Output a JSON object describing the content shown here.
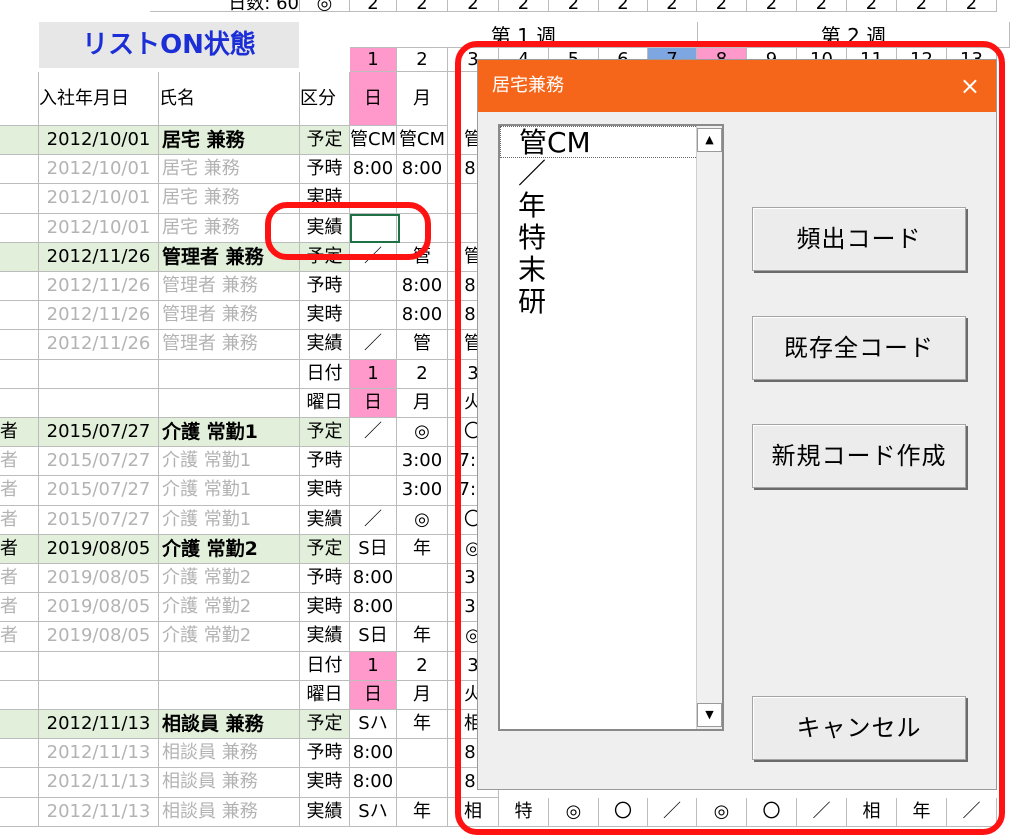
{
  "header": {
    "top_label": "日数: 60",
    "top_symbol": "◎"
  },
  "sheet_title": "リストON状態",
  "weeks": [
    "第 1 週",
    "第 2 週"
  ],
  "col_headers": {
    "date": "入社年月日",
    "name": "氏名",
    "kubun": "区分"
  },
  "days_number_row": [
    "2",
    "2",
    "2",
    "2",
    "2",
    "2",
    "2",
    "2",
    "2",
    "2",
    "2",
    "2",
    "2"
  ],
  "header_day_nums": [
    "1",
    "2",
    "3",
    "4",
    "5",
    "6",
    "7",
    "8",
    "9",
    "10",
    "11",
    "12",
    "13"
  ],
  "header_weekdays": [
    "日",
    "月"
  ],
  "rows": [
    {
      "kind": "emp",
      "date": "2012/10/01",
      "name": "居宅 兼務",
      "type": "予定",
      "bold": true,
      "cells": [
        "管CM",
        "管CM",
        "管"
      ]
    },
    {
      "kind": "emp",
      "date": "2012/10/01",
      "name": "居宅 兼務",
      "type": "予時",
      "grey": true,
      "cells": [
        "8:00",
        "8:00",
        "8:"
      ]
    },
    {
      "kind": "emp",
      "date": "2012/10/01",
      "name": "居宅 兼務",
      "type": "実時",
      "grey": true,
      "cells": [
        "",
        "",
        ""
      ]
    },
    {
      "kind": "emp",
      "date": "2012/10/01",
      "name": "居宅 兼務",
      "type": "実績",
      "grey": true,
      "cells": [
        "",
        "",
        ""
      ]
    },
    {
      "kind": "emp",
      "date": "2012/11/26",
      "name": "管理者 兼務",
      "type": "予定",
      "bold": true,
      "cells": [
        "／",
        "管",
        "管"
      ]
    },
    {
      "kind": "emp",
      "date": "2012/11/26",
      "name": "管理者 兼務",
      "type": "予時",
      "grey": true,
      "cells": [
        "",
        "8:00",
        "8:"
      ]
    },
    {
      "kind": "emp",
      "date": "2012/11/26",
      "name": "管理者 兼務",
      "type": "実時",
      "grey": true,
      "cells": [
        "",
        "8:00",
        "8:"
      ]
    },
    {
      "kind": "emp",
      "date": "2012/11/26",
      "name": "管理者 兼務",
      "type": "実績",
      "grey": true,
      "cells": [
        "／",
        "管",
        "管"
      ]
    },
    {
      "kind": "sub",
      "type": "日付",
      "cells": [
        "1",
        "2",
        "3"
      ]
    },
    {
      "kind": "sub",
      "type": "曜日",
      "cells": [
        "日",
        "月",
        "火"
      ]
    },
    {
      "kind": "emp",
      "pre": "者",
      "date": "2015/07/27",
      "name": "介護 常勤1",
      "type": "予定",
      "bold": true,
      "cells": [
        "／",
        "◎",
        "〇"
      ]
    },
    {
      "kind": "emp",
      "pre": "者",
      "date": "2015/07/27",
      "name": "介護 常勤1",
      "type": "予時",
      "grey": true,
      "cells": [
        "",
        "3:00",
        "7:0"
      ]
    },
    {
      "kind": "emp",
      "pre": "者",
      "date": "2015/07/27",
      "name": "介護 常勤1",
      "type": "実時",
      "grey": true,
      "cells": [
        "",
        "3:00",
        "7:0"
      ]
    },
    {
      "kind": "emp",
      "pre": "者",
      "date": "2015/07/27",
      "name": "介護 常勤1",
      "type": "実績",
      "grey": true,
      "cells": [
        "／",
        "◎",
        "〇"
      ]
    },
    {
      "kind": "emp",
      "pre": "者",
      "date": "2019/08/05",
      "name": "介護 常勤2",
      "type": "予定",
      "bold": true,
      "cells": [
        "S日",
        "年",
        "◎"
      ]
    },
    {
      "kind": "emp",
      "pre": "者",
      "date": "2019/08/05",
      "name": "介護 常勤2",
      "type": "予時",
      "grey": true,
      "cells": [
        "8:00",
        "",
        "3:"
      ]
    },
    {
      "kind": "emp",
      "pre": "者",
      "date": "2019/08/05",
      "name": "介護 常勤2",
      "type": "実時",
      "grey": true,
      "cells": [
        "8:00",
        "",
        "3:"
      ]
    },
    {
      "kind": "emp",
      "pre": "者",
      "date": "2019/08/05",
      "name": "介護 常勤2",
      "type": "実績",
      "grey": true,
      "cells": [
        "S日",
        "年",
        "◎"
      ]
    },
    {
      "kind": "sub",
      "type": "日付",
      "cells": [
        "1",
        "2",
        "3"
      ]
    },
    {
      "kind": "sub",
      "type": "曜日",
      "cells": [
        "日",
        "月",
        "火"
      ]
    },
    {
      "kind": "emp",
      "date": "2012/11/13",
      "name": "相談員 兼務",
      "type": "予定",
      "bold": true,
      "cells": [
        "Sハ",
        "年",
        "相"
      ]
    },
    {
      "kind": "emp",
      "date": "2012/11/13",
      "name": "相談員 兼務",
      "type": "予時",
      "grey": true,
      "cells": [
        "8:00",
        "",
        "8:"
      ]
    },
    {
      "kind": "emp",
      "date": "2012/11/13",
      "name": "相談員 兼務",
      "type": "実時",
      "grey": true,
      "cells": [
        "8:00",
        "",
        "8:"
      ]
    },
    {
      "kind": "emp",
      "date": "2012/11/13",
      "name": "相談員 兼務",
      "type": "実績",
      "grey": true,
      "cells": [
        "Sハ",
        "年",
        "相"
      ]
    }
  ],
  "bottom_extra_cells": [
    "特",
    "◎",
    "〇",
    "／",
    "◎",
    "〇",
    "／",
    "相",
    "年",
    "／"
  ],
  "dialog": {
    "title": "居宅兼務",
    "close": "×",
    "list_items": [
      "管CM",
      "／",
      "年",
      "特",
      "末",
      "研"
    ],
    "scroll_up": "▲",
    "scroll_down": "▼",
    "buttons": [
      "頻出コード",
      "既存全コード",
      "新規コード作成",
      "キャンセル"
    ]
  },
  "colors": {
    "title_bar": "#f6661a",
    "highlight": "#ff1212",
    "group_row": "#e2efda",
    "sunday": "#ff99cc",
    "sheet_title_text": "#1c2fd6"
  }
}
